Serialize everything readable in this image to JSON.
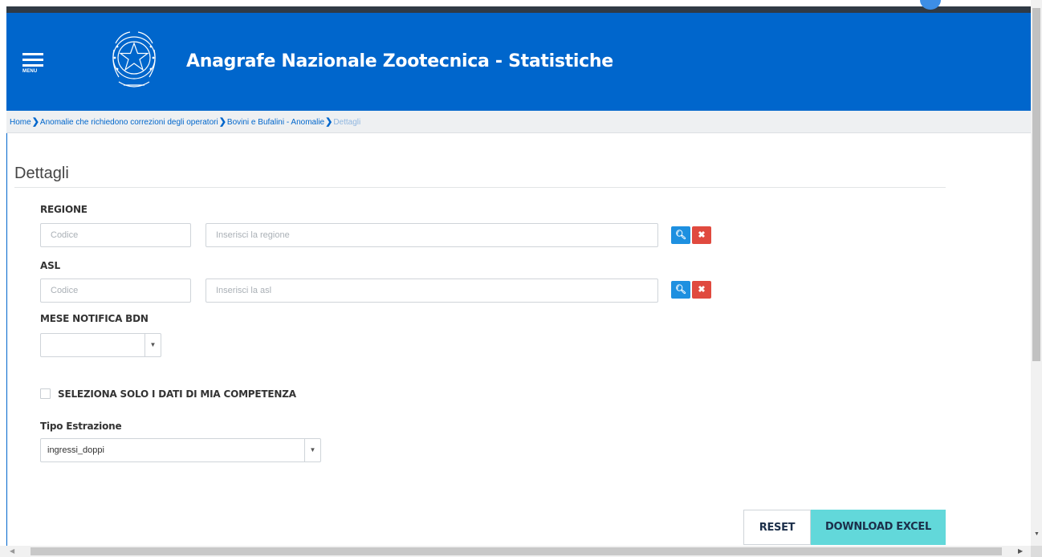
{
  "header": {
    "title": "Anagrafe Nazionale Zootecnica - Statistiche",
    "menu_label": "MENU",
    "brand_color": "#0066cc"
  },
  "breadcrumb": {
    "items": [
      "Home",
      "Anomalie che richiedono correzioni degli operatori",
      "Bovini e Bufalini - Anomalie"
    ],
    "current": "Dettagli"
  },
  "page": {
    "title": "Dettagli"
  },
  "form": {
    "regione": {
      "label": "REGIONE",
      "code_placeholder": "Codice",
      "name_placeholder": "Inserisci la regione"
    },
    "asl": {
      "label": "ASL",
      "code_placeholder": "Codice",
      "name_placeholder": "Inserisci la asl"
    },
    "mese": {
      "label": "MESE NOTIFICA BDN",
      "value": ""
    },
    "competenza": {
      "label": "SELEZIONA SOLO I DATI DI MIA COMPETENZA",
      "checked": false
    },
    "tipo": {
      "label": "Tipo Estrazione",
      "value": "ingressi_doppi"
    }
  },
  "actions": {
    "reset_label": "RESET",
    "download_label": "DOWNLOAD EXCEL",
    "download_color": "#62d8da"
  },
  "icons": {
    "search": "search-icon",
    "clear": "times-icon",
    "caret": "caret-down-icon"
  }
}
